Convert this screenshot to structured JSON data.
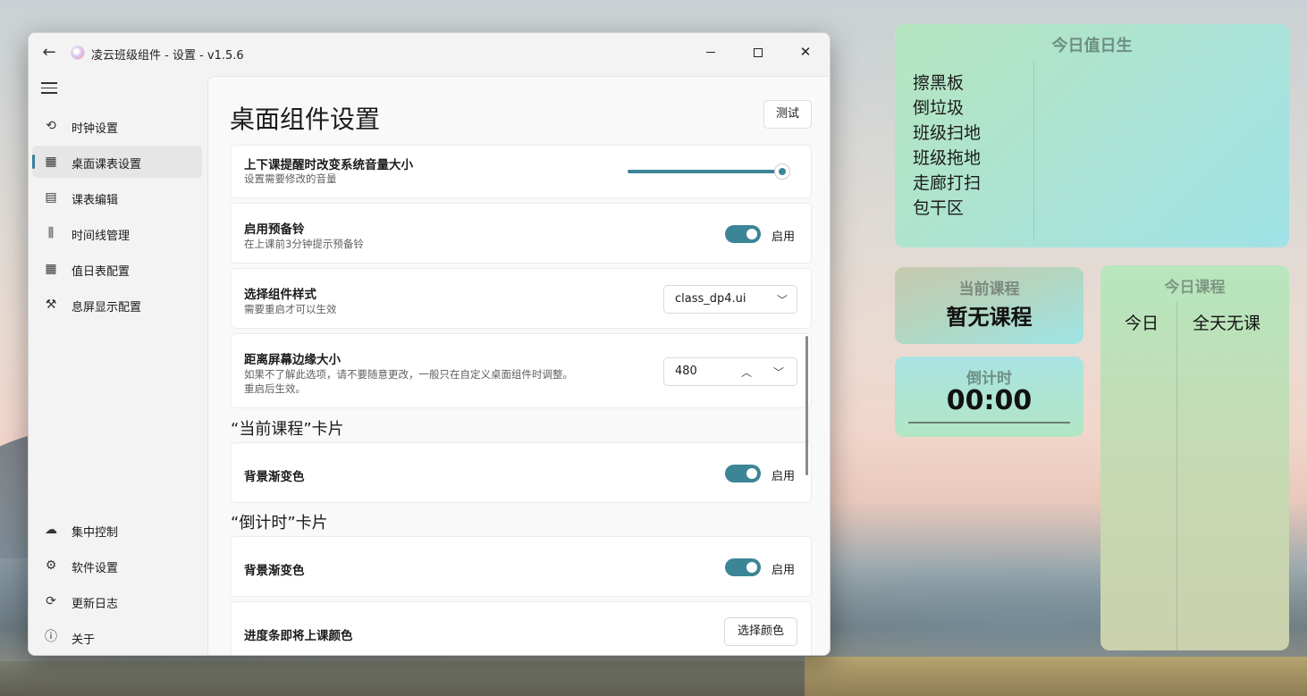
{
  "window": {
    "title": "凌云班级组件 - 设置 - v1.5.6",
    "back_icon": "arrow-left-icon",
    "close_glyph": "✕"
  },
  "sidebar": {
    "items": [
      {
        "label": "时钟设置",
        "icon": "clock-history-icon",
        "glyph": "⟲"
      },
      {
        "label": "桌面课表设置",
        "icon": "grid-apps-icon",
        "glyph": "▦",
        "active": true
      },
      {
        "label": "课表编辑",
        "icon": "calendar-icon",
        "glyph": "▤"
      },
      {
        "label": "时间线管理",
        "icon": "library-icon",
        "glyph": "⫼"
      },
      {
        "label": "值日表配置",
        "icon": "calendar-grid-icon",
        "glyph": "▦"
      },
      {
        "label": "息屏显示配置",
        "icon": "tools-icon",
        "glyph": "⚒"
      }
    ],
    "bottom_items": [
      {
        "label": "集中控制",
        "icon": "cloud-icon",
        "glyph": "☁"
      },
      {
        "label": "软件设置",
        "icon": "gear-icon",
        "glyph": "⚙"
      },
      {
        "label": "更新日志",
        "icon": "refresh-icon",
        "glyph": "⟳"
      },
      {
        "label": "关于",
        "icon": "info-icon",
        "glyph": "ⓘ"
      }
    ]
  },
  "main": {
    "page_title": "桌面组件设置",
    "test_button": "测试",
    "volume": {
      "title": "上下课提醒时改变系统音量大小",
      "desc": "设置需要修改的音量",
      "value_fraction": 0.95
    },
    "prebell": {
      "title": "启用预备铃",
      "desc": "在上课前3分钟提示预备铃",
      "toggle_label": "启用"
    },
    "style": {
      "title": "选择组件样式",
      "desc": "需要重启才可以生效",
      "selected": "class_dp4.ui"
    },
    "margin": {
      "title": "距离屏幕边缘大小",
      "desc_line1": "如果不了解此选项，请不要随意更改，一般只在自定义桌面组件时调整。",
      "desc_line2": "重启后生效。",
      "value": "480"
    },
    "section_current": "“当前课程”卡片",
    "current_gradient": {
      "title": "背景渐变色",
      "toggle_label": "启用"
    },
    "section_countdown": "“倒计时”卡片",
    "countdown_gradient": {
      "title": "背景渐变色",
      "toggle_label": "启用"
    },
    "progress_color": {
      "title": "进度条即将上课颜色",
      "button": "选择颜色"
    }
  },
  "widgets": {
    "duty": {
      "title": "今日值日生",
      "items": [
        "擦黑板",
        "倒垃圾",
        "班级扫地",
        "班级拖地",
        "走廊打扫",
        "包干区"
      ]
    },
    "current": {
      "label": "当前课程",
      "value": "暂无课程"
    },
    "countdown": {
      "label": "倒计时",
      "value": "00:00"
    },
    "today": {
      "title": "今日课程",
      "day": "今日",
      "course": "全天无课"
    }
  },
  "colors": {
    "accent": "#3b8597"
  }
}
